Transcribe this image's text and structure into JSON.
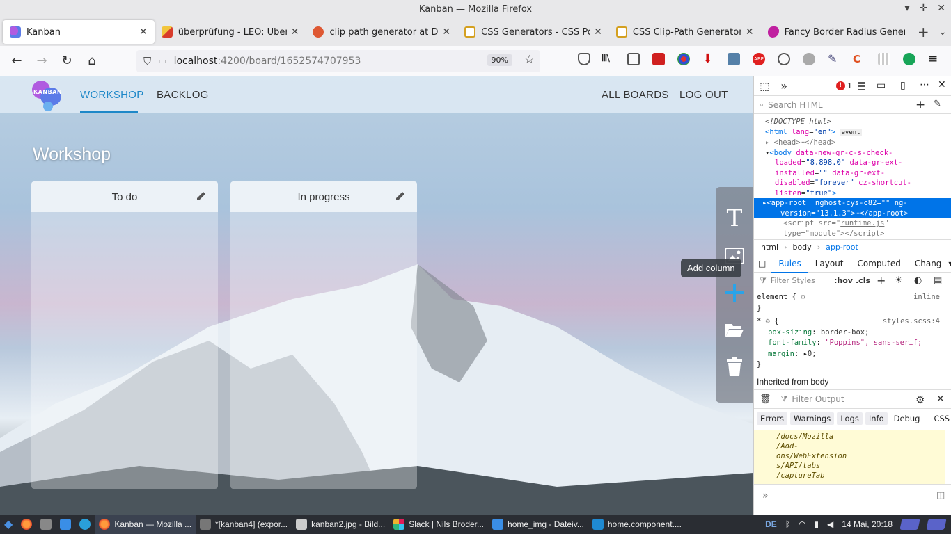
{
  "window": {
    "title": "Kanban — Mozilla Firefox"
  },
  "tabs": [
    {
      "label": "Kanban",
      "active": true,
      "icon": "kanban-favicon",
      "color": "#8a4ef0"
    },
    {
      "label": "überprüfung - LEO: Übersetz",
      "active": false,
      "icon": "leo-favicon",
      "color": "#e8a020"
    },
    {
      "label": "clip path generator at DuckD",
      "active": false,
      "icon": "duckduckgo-favicon",
      "color": "#de5833"
    },
    {
      "label": "CSS Generators - CSS Portal",
      "active": false,
      "icon": "cssportal-favicon",
      "color": "#d4a020"
    },
    {
      "label": "CSS Clip-Path Generator - CSS",
      "active": false,
      "icon": "cssportal-favicon",
      "color": "#d4a020"
    },
    {
      "label": "Fancy Border Radius Generat",
      "active": false,
      "icon": "fancy-border-favicon",
      "color": "#c020a0"
    }
  ],
  "navbar": {
    "url_host": "localhost",
    "url_path": ":4200/board/1652574707953",
    "zoom": "90%"
  },
  "app": {
    "logo_text": "KANBAN",
    "nav": [
      "WORKSHOP",
      "BACKLOG"
    ],
    "nav_right": [
      "ALL BOARDS",
      "LOG OUT"
    ],
    "board_title": "Workshop",
    "columns": [
      {
        "title": "To do"
      },
      {
        "title": "In progress"
      }
    ],
    "tools": [
      "text-icon",
      "image-icon",
      "add-icon",
      "folder-icon",
      "trash-icon"
    ],
    "tooltip": "Add column"
  },
  "devtools": {
    "error_count": "1",
    "search_placeholder": "Search HTML",
    "crumbs": [
      "html",
      "body",
      "app-root"
    ],
    "rule_tabs": [
      "Rules",
      "Layout",
      "Computed",
      "Chang"
    ],
    "filter_placeholder": "Filter Styles",
    "hov": ":hov",
    "cls": ".cls",
    "element_rule": "element {",
    "inline": "inline",
    "star_source": "styles.scss:4",
    "props": [
      {
        "name": "box-sizing",
        "value": "border-box;"
      },
      {
        "name": "font-family",
        "value": "\"Poppins\", sans-serif;"
      },
      {
        "name": "margin",
        "value": "0;"
      }
    ],
    "inherited": "Inherited from body",
    "console_filter": "Filter Output",
    "console_filters": [
      "Errors",
      "Warnings",
      "Logs",
      "Info",
      "Debug",
      "CSS"
    ],
    "console_lines": [
      "/docs/Mozilla",
      "/Add-",
      "ons/WebExtension",
      "s/API/tabs",
      "/captureTab"
    ]
  },
  "taskbar": {
    "items": [
      {
        "label": "Kanban — Mozilla ...",
        "active": true
      },
      {
        "label": "*[kanban4] (expor...",
        "active": false
      },
      {
        "label": "kanban2.jpg - Bild...",
        "active": false
      },
      {
        "label": "Slack | Nils Broder...",
        "active": false
      },
      {
        "label": "home_img - Dateiv...",
        "active": false
      },
      {
        "label": "home.component....",
        "active": false
      }
    ],
    "lang": "DE",
    "clock": "14 Mai, 20:18"
  }
}
